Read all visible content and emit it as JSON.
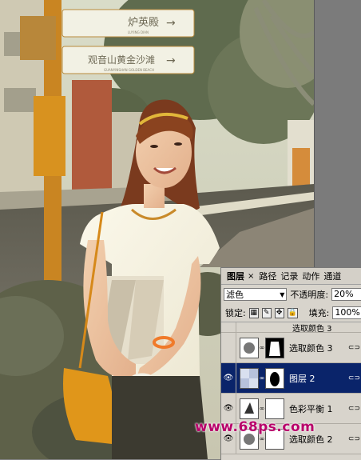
{
  "photo": {
    "signs": [
      {
        "main": "炉英殿",
        "sub": "LUYING DIAN"
      },
      {
        "main": "观音山黄金沙滩",
        "sub": "GUANYINSHAN GOLDEN BEACH"
      }
    ],
    "sign_arrow": "→"
  },
  "layers_panel": {
    "tabs": [
      "图层",
      "路径",
      "记录",
      "动作",
      "通道"
    ],
    "tab_close": "×",
    "blend_mode": "滤色",
    "opacity_label": "不透明度:",
    "opacity_value": "20%",
    "lock_label": "锁定:",
    "fill_label": "填充:",
    "fill_value": "100%",
    "layers": [
      {
        "name": "选取颜色 3",
        "visible": false,
        "selected": false
      },
      {
        "name": "图层 2",
        "visible": true,
        "selected": true
      },
      {
        "name": "色彩平衡 1",
        "visible": true,
        "selected": false
      },
      {
        "name": "选取颜色 2",
        "visible": true,
        "selected": false
      }
    ],
    "partial_layer_name": "选取颜色 3"
  },
  "watermark": "www.68ps.com",
  "colors": {
    "accent_selected": "#0a246a",
    "watermark": "#b8006a"
  }
}
